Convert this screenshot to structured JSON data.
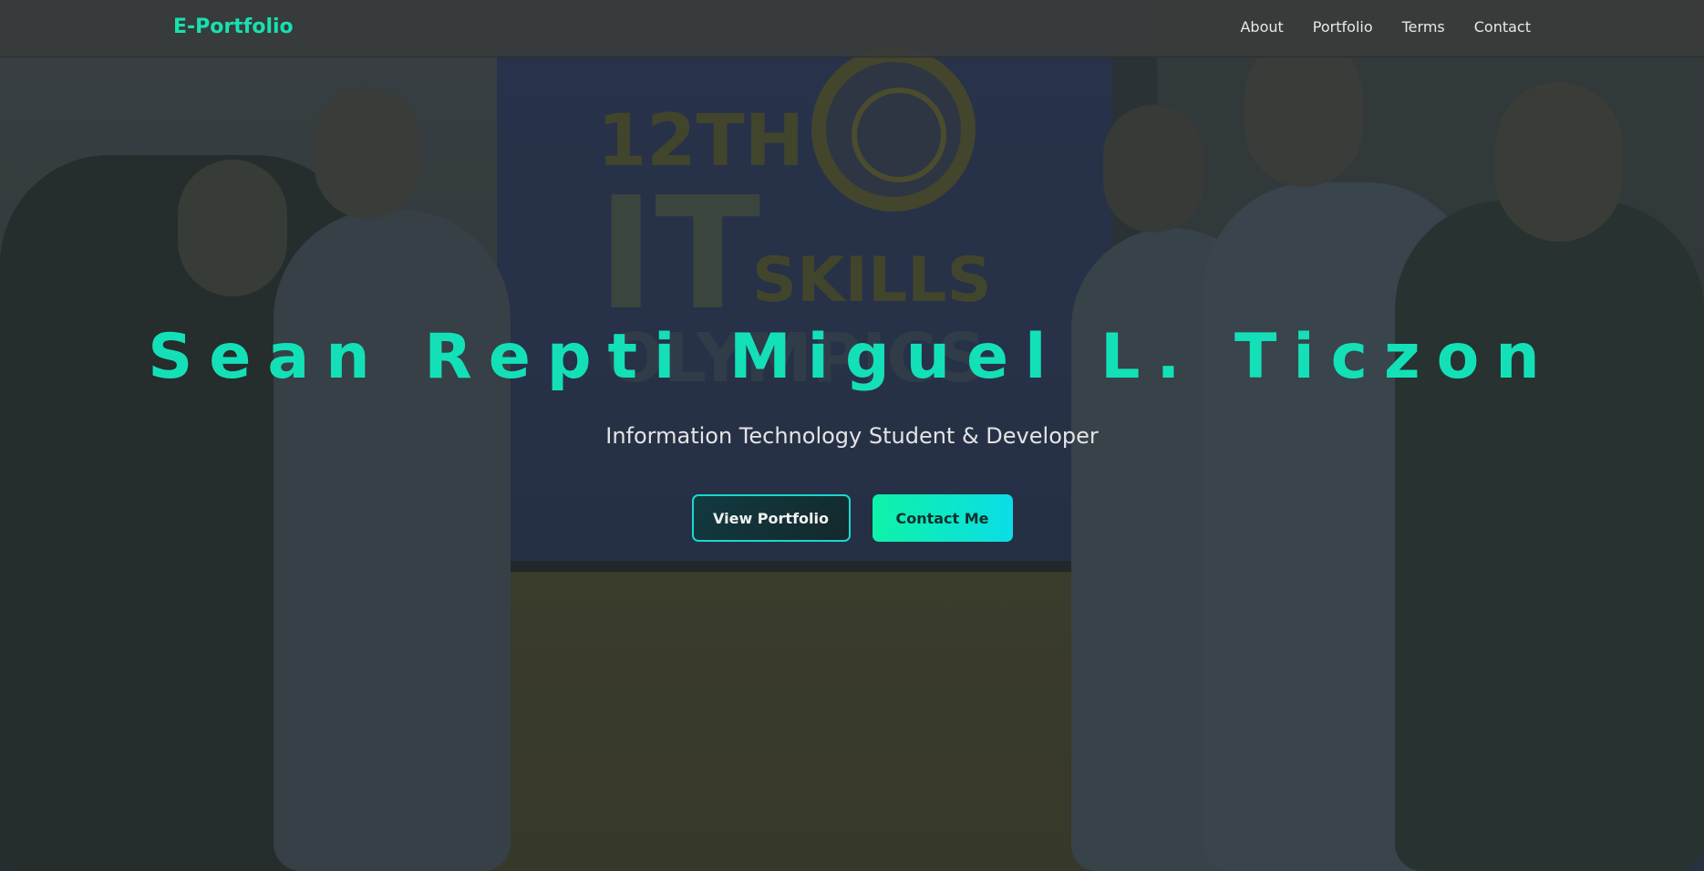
{
  "navbar": {
    "brand": "E-Portfolio",
    "links": [
      "About",
      "Portfolio",
      "Terms",
      "Contact"
    ]
  },
  "hero": {
    "name": "Sean Repti Miguel L. Ticzon",
    "subtitle": "Information Technology Student & Developer",
    "buttons": {
      "primary": "View Portfolio",
      "secondary": "Contact Me"
    }
  },
  "background_photo": {
    "banner_text": [
      "12TH",
      "IT",
      "SKILLS",
      "OLYMPICS"
    ]
  },
  "colors": {
    "accent": "#14e0b8",
    "button_gradient_start": "#0ef2a8",
    "button_gradient_end": "#0bdde6",
    "navbar_bg": "#3a3c3c"
  }
}
